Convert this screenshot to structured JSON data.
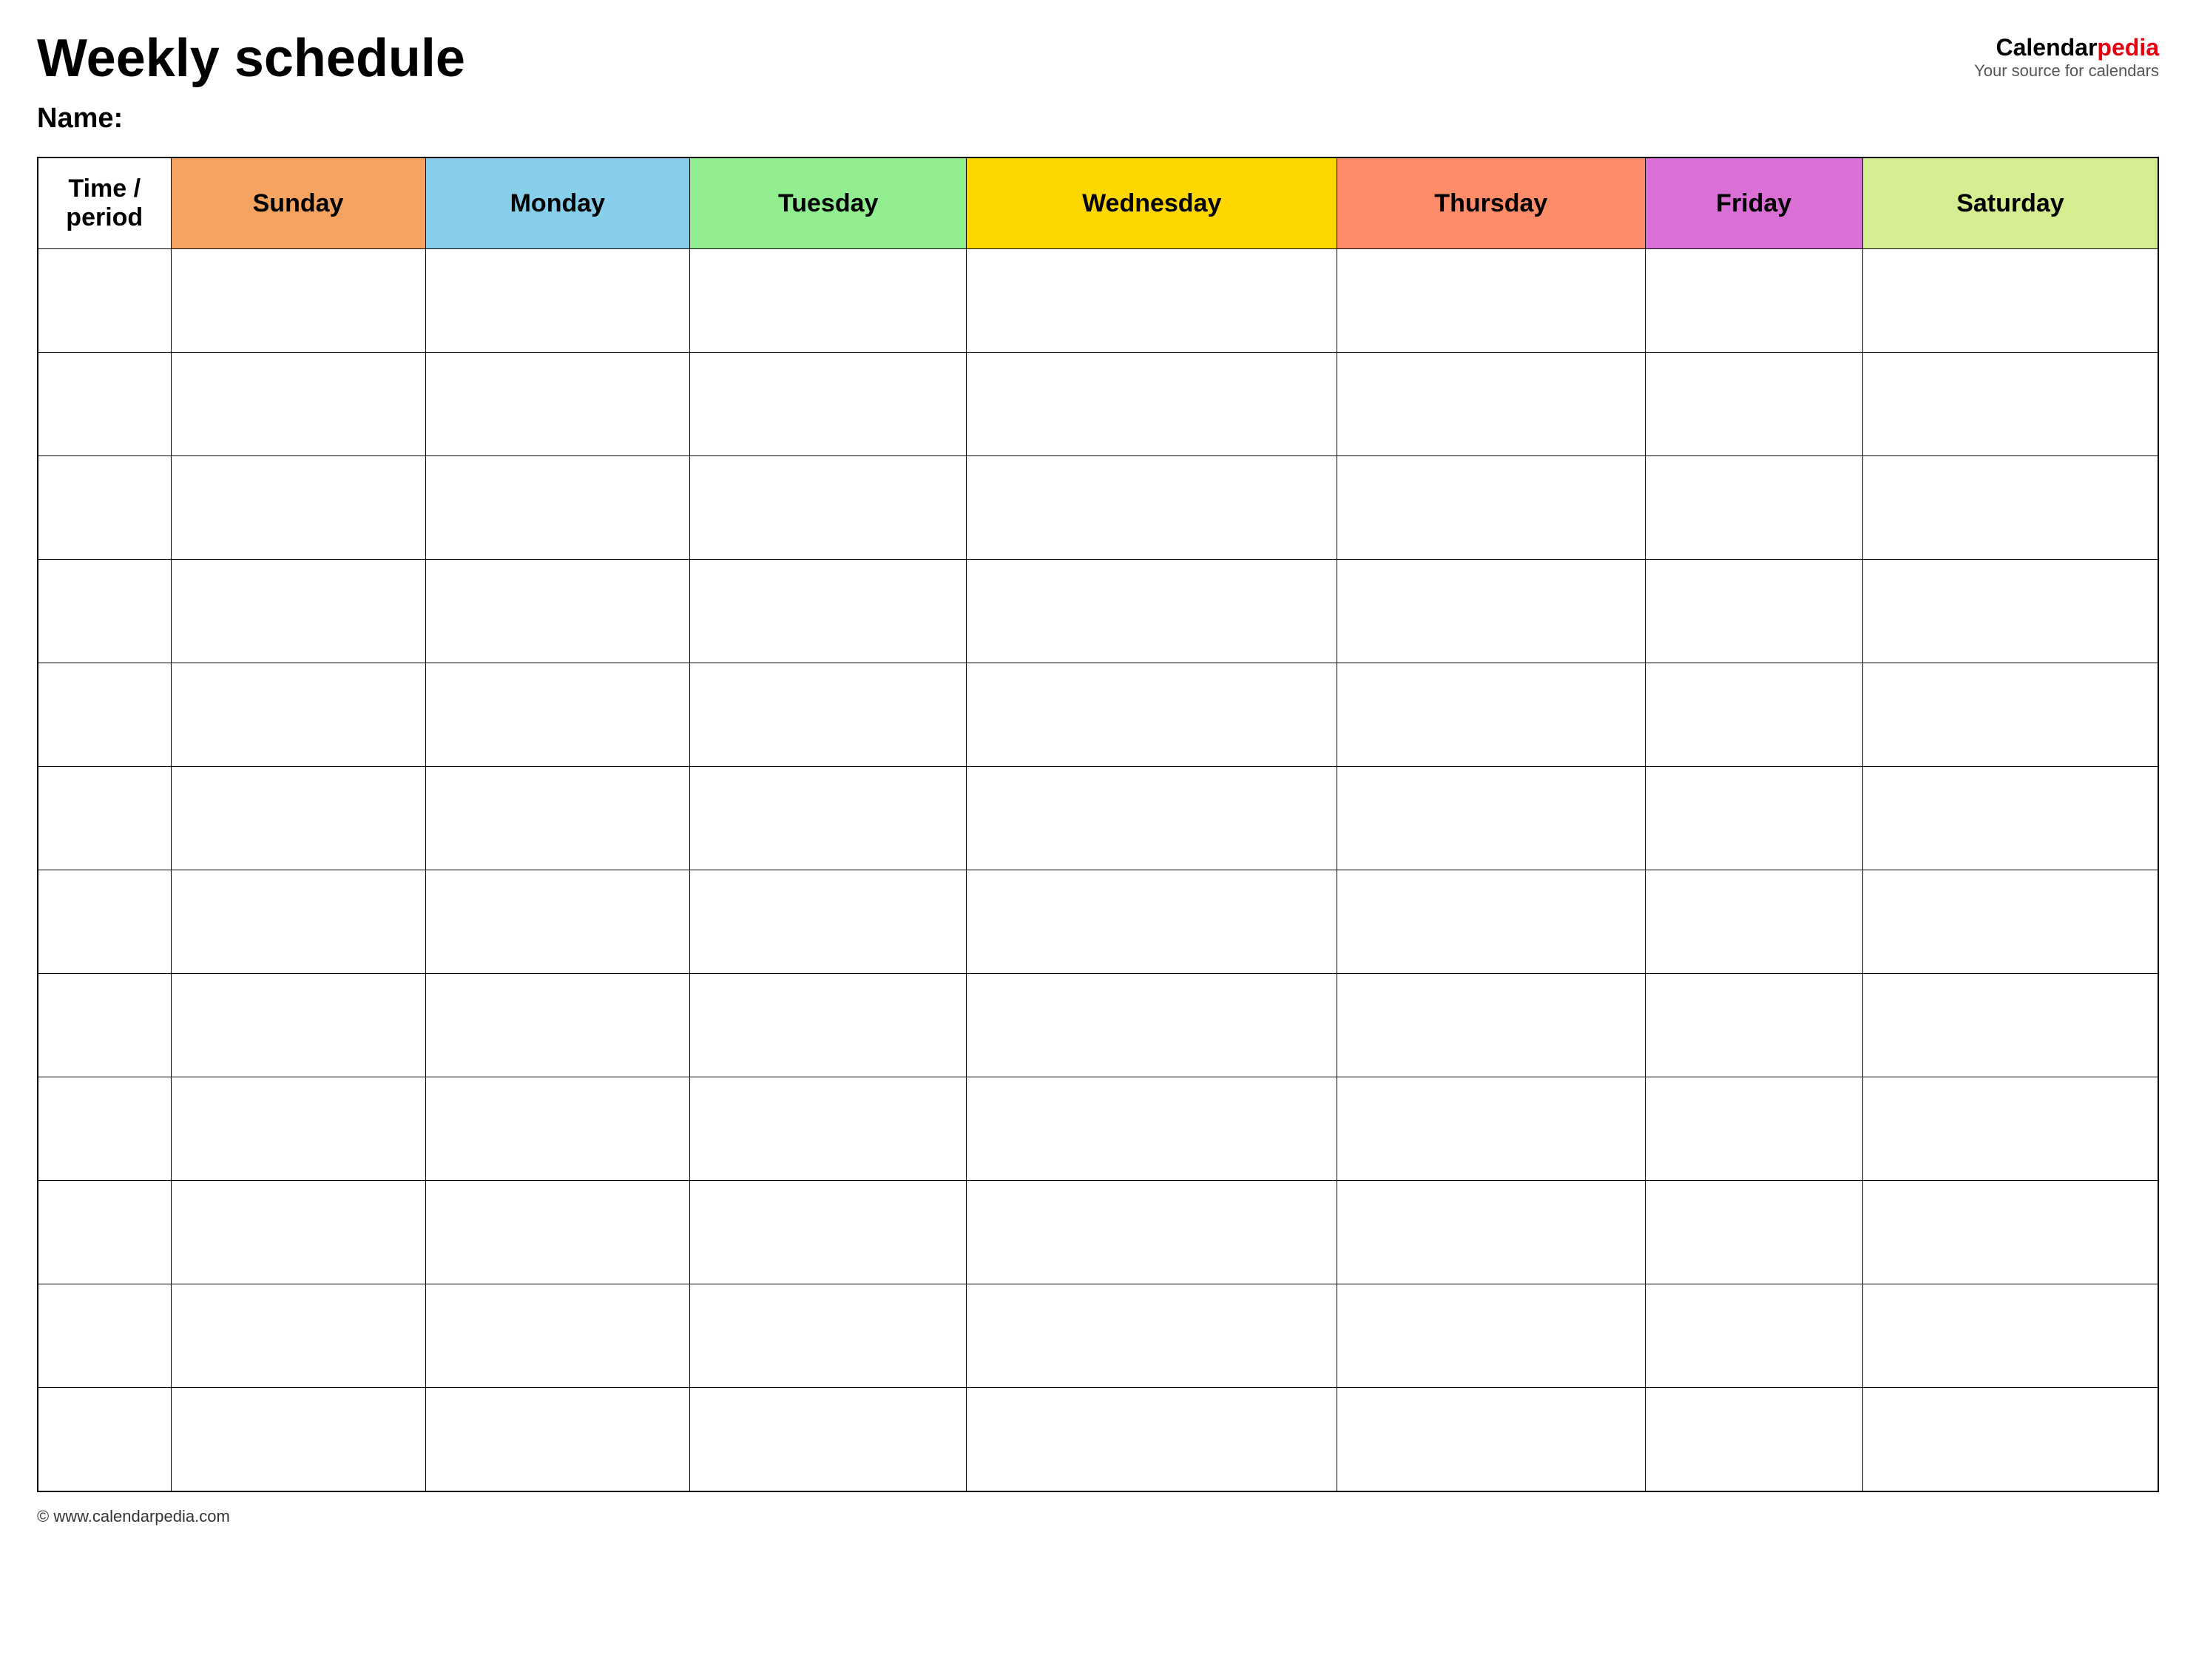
{
  "page": {
    "title": "Weekly schedule",
    "name_label": "Name:",
    "footer_text": "© www.calendarpedia.com"
  },
  "logo": {
    "text_black": "Calendar",
    "text_red": "pedia",
    "tagline": "Your source for calendars"
  },
  "table": {
    "headers": [
      {
        "id": "time",
        "label": "Time / period",
        "color_class": "col-time"
      },
      {
        "id": "sunday",
        "label": "Sunday",
        "color_class": "col-sunday"
      },
      {
        "id": "monday",
        "label": "Monday",
        "color_class": "col-monday"
      },
      {
        "id": "tuesday",
        "label": "Tuesday",
        "color_class": "col-tuesday"
      },
      {
        "id": "wednesday",
        "label": "Wednesday",
        "color_class": "col-wednesday"
      },
      {
        "id": "thursday",
        "label": "Thursday",
        "color_class": "col-thursday"
      },
      {
        "id": "friday",
        "label": "Friday",
        "color_class": "col-friday"
      },
      {
        "id": "saturday",
        "label": "Saturday",
        "color_class": "col-saturday"
      }
    ],
    "row_count": 12
  }
}
